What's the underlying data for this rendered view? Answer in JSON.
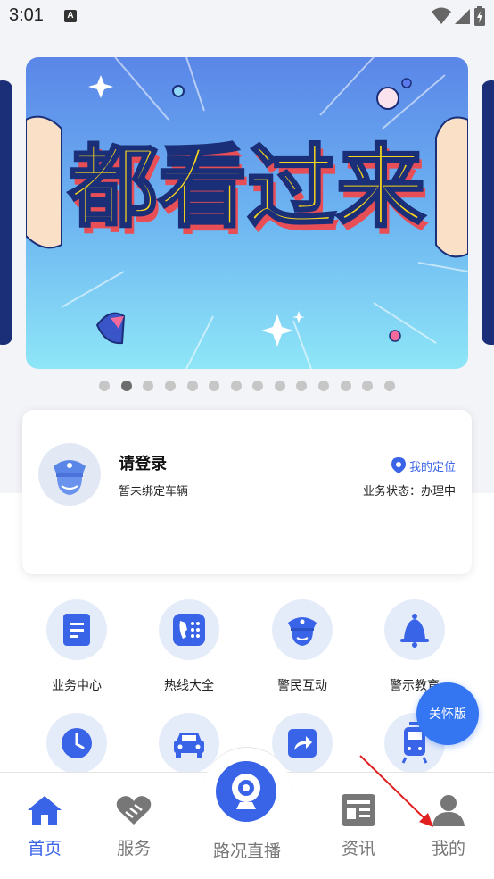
{
  "status_bar": {
    "time": "3:01",
    "notification_letter": "A"
  },
  "banner": {
    "headline": "都看过来",
    "slide_count": 14,
    "active_index": 1
  },
  "login_card": {
    "title": "请登录",
    "subtitle": "暂未绑定车辆",
    "location_label": "我的定位",
    "business_status": "业务状态：办理中"
  },
  "services": [
    {
      "label": "业务中心",
      "icon": "document-icon"
    },
    {
      "label": "热线大全",
      "icon": "phone-icon"
    },
    {
      "label": "警民互动",
      "icon": "police-cap-icon"
    },
    {
      "label": "警示教育",
      "icon": "bell-icon"
    },
    {
      "label": "",
      "icon": "clock-icon"
    },
    {
      "label": "",
      "icon": "car-icon"
    },
    {
      "label": "",
      "icon": "share-icon"
    },
    {
      "label": "",
      "icon": "train-icon"
    }
  ],
  "care_button": {
    "label": "关怀版"
  },
  "tabbar": {
    "home": "首页",
    "service": "服务",
    "live": "路况直播",
    "news": "资讯",
    "mine": "我的",
    "active": "home"
  },
  "colors": {
    "accent": "#3a64e8",
    "banner_text": "#f7d61c",
    "banner_shadow": "#e84e55",
    "banner_bg": "#5b8de8"
  }
}
